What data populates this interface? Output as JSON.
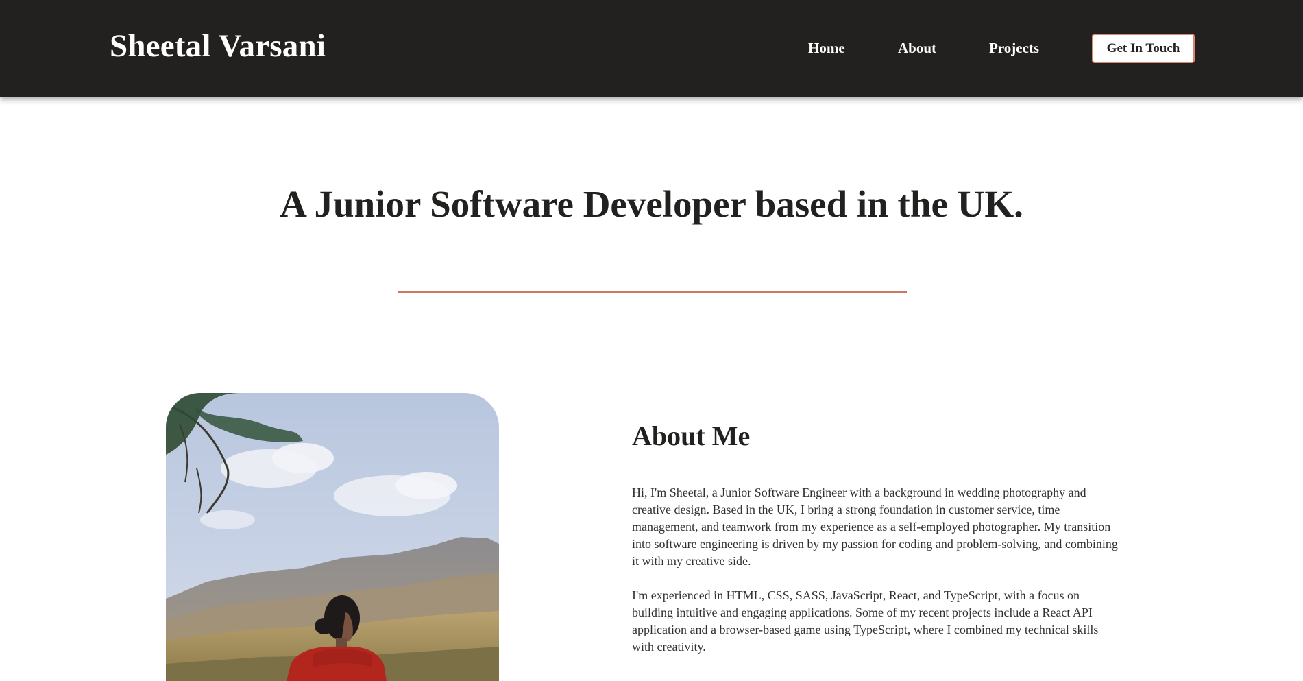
{
  "brand": {
    "name": "Sheetal Varsani"
  },
  "nav": {
    "items": [
      {
        "label": "Home"
      },
      {
        "label": "About"
      },
      {
        "label": "Projects"
      }
    ],
    "cta_label": "Get In Touch"
  },
  "hero": {
    "headline": "A Junior Software Developer based in the UK."
  },
  "about": {
    "title": "About Me",
    "paragraphs": [
      "Hi, I'm Sheetal, a Junior Software Engineer with a background in wedding photography and creative design. Based in the UK, I bring a strong foundation in customer service, time management, and teamwork from my experience as a self-employed photographer. My transition into software engineering is driven by my passion for coding and problem-solving, and combining it with my creative side.",
      "I'm experienced in HTML, CSS, SASS, JavaScript, React, and TypeScript, with a focus on building intuitive and engaging applications. Some of my recent projects include a React API application and a browser-based game using TypeScript, where I combined my technical skills with creativity."
    ]
  },
  "colors": {
    "navbar_bg": "#232120",
    "accent": "#c8795f",
    "text": "#222120"
  }
}
